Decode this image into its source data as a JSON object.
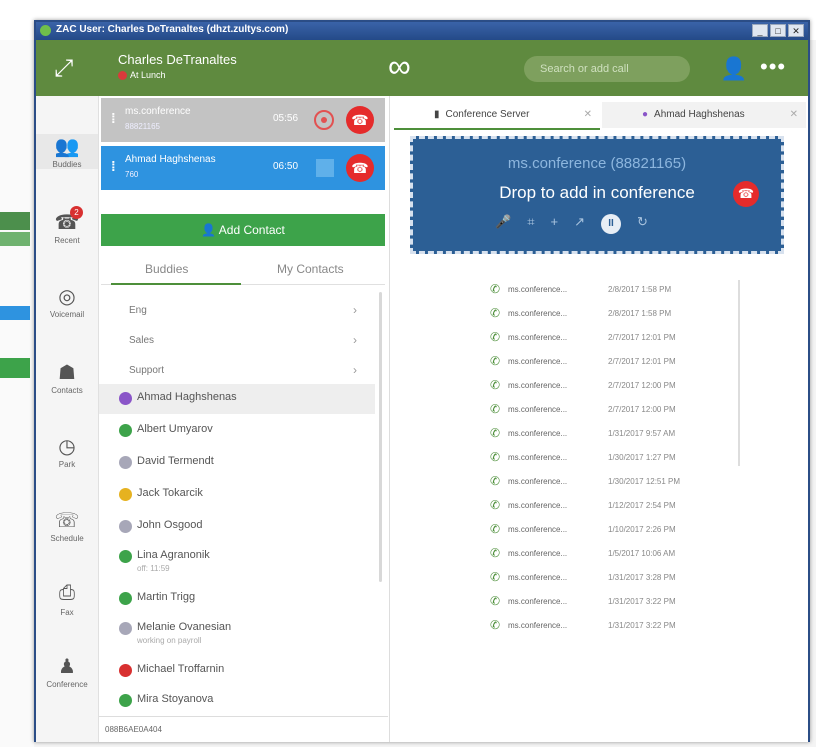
{
  "window": {
    "title": "ZAC User: Charles DeTranaltes (dhzt.zultys.com)",
    "controls": [
      "_",
      "□",
      "✕"
    ]
  },
  "header": {
    "user_name": "Charles DeTranaltes",
    "status": "At Lunch",
    "search_placeholder": "Search or add call",
    "colors": {
      "header": "#5f8a3f",
      "accent_green": "#3da34a",
      "hangup_red": "#e52b2b",
      "call_blue": "#2e93e0"
    }
  },
  "nav": [
    {
      "label": "Buddies",
      "icon": "buddies-icon"
    },
    {
      "label": "Recent",
      "icon": "recent-calls-icon",
      "badge": "2"
    },
    {
      "label": "Voicemail",
      "icon": "voicemail-icon"
    },
    {
      "label": "Contacts",
      "icon": "contacts-icon"
    },
    {
      "label": "Park",
      "icon": "park-icon"
    },
    {
      "label": "Schedule",
      "icon": "schedule-icon"
    },
    {
      "label": "Fax",
      "icon": "fax-icon"
    },
    {
      "label": "Conference",
      "icon": "conference-icon"
    }
  ],
  "calls": [
    {
      "name": "ms.conference",
      "sub": "88821165",
      "time": "05:56"
    },
    {
      "name": "Ahmad Haghshenas",
      "sub": "760",
      "time": "06:50"
    }
  ],
  "add_contact": "Add Contact",
  "tabs": {
    "buddies": "Buddies",
    "my_contacts": "My Contacts"
  },
  "groups": [
    "Eng",
    "Sales",
    "Support"
  ],
  "contacts": [
    {
      "name": "Ahmad Haghshenas",
      "status": "",
      "color": "#8a55c8"
    },
    {
      "name": "Albert Umyarov",
      "status": "",
      "color": "#3da34a"
    },
    {
      "name": "David Termendt",
      "status": "",
      "color": "#a7a7b8"
    },
    {
      "name": "Jack Tokarcik",
      "status": "",
      "color": "#e6b220"
    },
    {
      "name": "John Osgood",
      "status": "",
      "color": "#a7a7b8"
    },
    {
      "name": "Lina Agranonik",
      "status": "off: 11:59",
      "color": "#3da34a"
    },
    {
      "name": "Martin Trigg",
      "status": "",
      "color": "#3da34a"
    },
    {
      "name": "Melanie Ovanesian",
      "status": "working on payroll",
      "color": "#a7a7b8"
    },
    {
      "name": "Michael Troffarnin",
      "status": "",
      "color": "#d83030"
    },
    {
      "name": "Mira Stoyanova",
      "status": "",
      "color": "#3da34a"
    }
  ],
  "footer_id": "088B6AE0A404",
  "right_tabs": [
    {
      "label": "Conference Server"
    },
    {
      "label": "Ahmad Haghshenas"
    }
  ],
  "conference": {
    "name": "ms.conference (88821165)",
    "drop_text": "Drop to add in conference"
  },
  "history": [
    {
      "name": "ms.conference...",
      "date": "2/8/2017 1:58 PM"
    },
    {
      "name": "ms.conference...",
      "date": "2/8/2017 1:58 PM"
    },
    {
      "name": "ms.conference...",
      "date": "2/7/2017 12:01 PM"
    },
    {
      "name": "ms.conference...",
      "date": "2/7/2017 12:01 PM"
    },
    {
      "name": "ms.conference...",
      "date": "2/7/2017 12:00 PM"
    },
    {
      "name": "ms.conference...",
      "date": "2/7/2017 12:00 PM"
    },
    {
      "name": "ms.conference...",
      "date": "1/31/2017 9:57 AM"
    },
    {
      "name": "ms.conference...",
      "date": "1/30/2017 1:27 PM"
    },
    {
      "name": "ms.conference...",
      "date": "1/30/2017 12:51 PM"
    },
    {
      "name": "ms.conference...",
      "date": "1/12/2017 2:54 PM"
    },
    {
      "name": "ms.conference...",
      "date": "1/10/2017 2:26 PM"
    },
    {
      "name": "ms.conference...",
      "date": "1/5/2017 10:06 AM"
    },
    {
      "name": "ms.conference...",
      "date": "1/31/2017 3:28 PM"
    },
    {
      "name": "ms.conference...",
      "date": "1/31/2017 3:22 PM"
    },
    {
      "name": "ms.conference...",
      "date": "1/31/2017 3:22 PM"
    }
  ]
}
